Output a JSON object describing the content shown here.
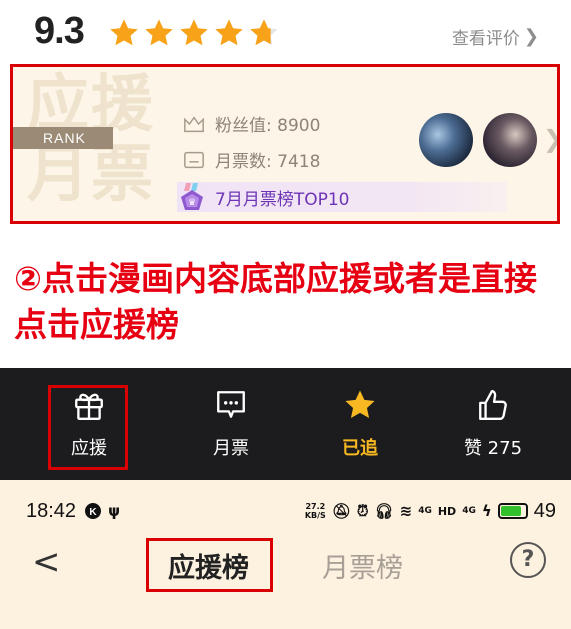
{
  "rating": {
    "score": "9.3",
    "stars_full": 4,
    "star_fraction_last": 0.7,
    "star_color": "#f7a218",
    "review_link_label": "查看评价"
  },
  "rank_card": {
    "background_text": "应援\n月票",
    "rank_label": "RANK",
    "fans_label": "粉丝值: 8900",
    "ticket_label": "月票数: 7418",
    "top_label": "7月月票榜TOP10",
    "highlight_color": "#d80000"
  },
  "instruction": {
    "text": "②点击漫画内容底部应援或者是直接点击应援榜"
  },
  "toolbar": {
    "support_label": "应援",
    "ticket_label": "月票",
    "follow_label": "已追",
    "like_label": "赞 275",
    "active_color": "#f7b822"
  },
  "status_bar": {
    "time": "18:42",
    "net_speed": "27.2\nKB/S",
    "signal_1": "4G",
    "hd_label": "HD",
    "signal_2": "4G",
    "battery": "49"
  },
  "nav": {
    "active_tab": "应援榜",
    "inactive_tab": "月票榜",
    "help": "?"
  }
}
